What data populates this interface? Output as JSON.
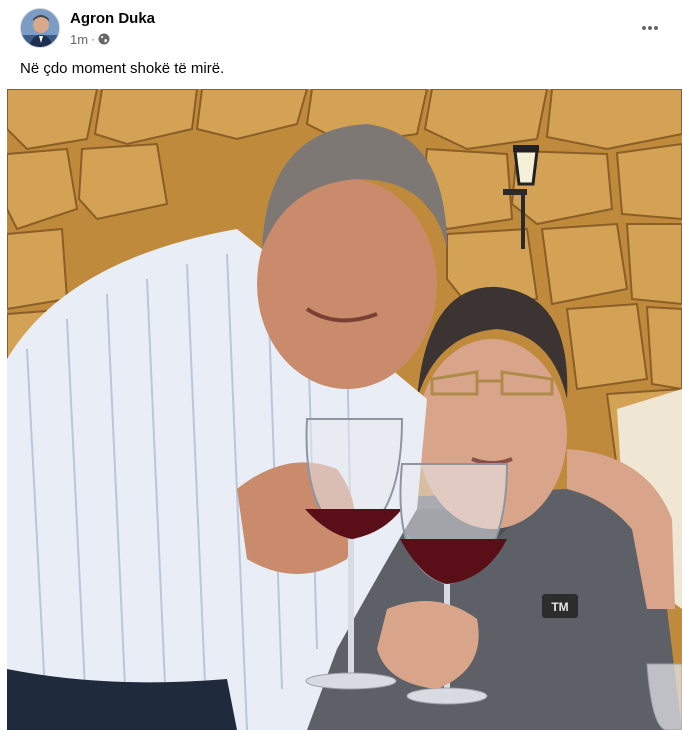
{
  "post": {
    "author": "Agron Duka",
    "time": "1m",
    "separator": "·",
    "audience_icon": "globe-icon",
    "menu_icon": "more-options-icon",
    "caption": "Në çdo moment shokë të mirë."
  },
  "photo": {
    "icon": "post-photo",
    "shirt_badge": "TM"
  },
  "colors": {
    "name": "#050505",
    "meta": "#65676b",
    "wall": "#c9953f",
    "wine": "#5a0f18"
  }
}
